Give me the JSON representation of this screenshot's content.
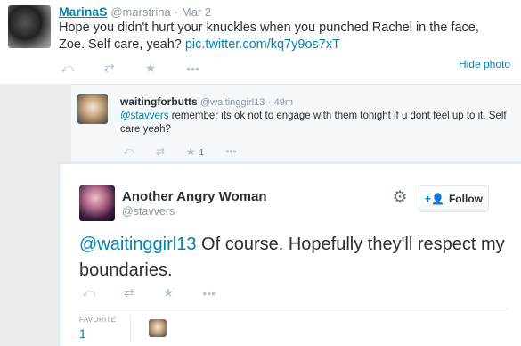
{
  "tweet1": {
    "name": "MarinaS",
    "handle": "@marstrina",
    "sep": "·",
    "date": "Mar 2",
    "text": "Hope you didn't hurt your knuckles when you punched Rachel in the face, Zoe. Self care, yeah?",
    "link": "pic.twitter.com/kq7y9os7xT",
    "hide_photo": "Hide photo",
    "actions": {
      "reply": "⤺",
      "retweet": "⇄",
      "favorite": "★",
      "more": "•••"
    }
  },
  "tweet2": {
    "name": "waitingforbutts",
    "handle": "@waitinggirl13",
    "sep": "·",
    "time": "49m",
    "mention": "@stavvers",
    "text": " remember its ok not to engage with them tonight if u dont feel up to it. Self care yeah?",
    "favorite_count": "1",
    "actions": {
      "reply": "⤺",
      "retweet": "⇄",
      "favorite": "★",
      "more": "•••"
    }
  },
  "tweet3": {
    "name": "Another Angry Woman",
    "handle": "@stavvers",
    "follow_label": "Follow",
    "follow_icon": "+👤",
    "gear": "⚙",
    "mention": "@waitinggirl13",
    "text": " Of course. Hopefully they'll respect my boundaries.",
    "favorite_label": "FAVORITE",
    "favorite_count": "1",
    "actions": {
      "reply": "⤺",
      "retweet": "⇄",
      "favorite": "★",
      "more": "•••"
    }
  },
  "colors": {
    "link": "#0084b4",
    "muted": "#8899a6",
    "icon": "#b8c3cb",
    "bg": "#e8ecef"
  }
}
